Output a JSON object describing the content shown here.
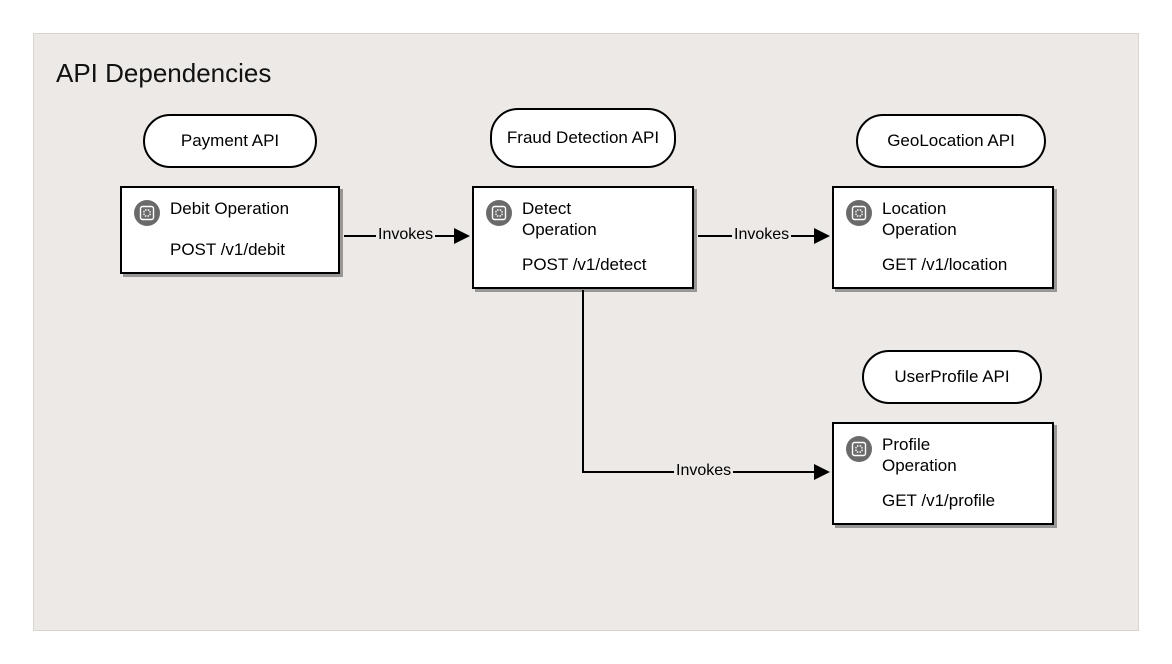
{
  "title": "API Dependencies",
  "apis": {
    "payment": {
      "label": "Payment API"
    },
    "fraud": {
      "label": "Fraud Detection API"
    },
    "geo": {
      "label": "GeoLocation API"
    },
    "profile": {
      "label": "UserProfile API"
    }
  },
  "operations": {
    "debit": {
      "name": "Debit Operation",
      "endpoint": "POST /v1/debit"
    },
    "detect": {
      "name": "Detect Operation",
      "endpoint": "POST /v1/detect"
    },
    "location": {
      "name": "Location Operation",
      "endpoint": "GET /v1/location"
    },
    "profile": {
      "name": "Profile Operation",
      "endpoint": "GET /v1/profile"
    }
  },
  "edges": {
    "debit_detect": {
      "label": "Invokes"
    },
    "detect_location": {
      "label": "Invokes"
    },
    "detect_profile": {
      "label": "Invokes"
    }
  }
}
